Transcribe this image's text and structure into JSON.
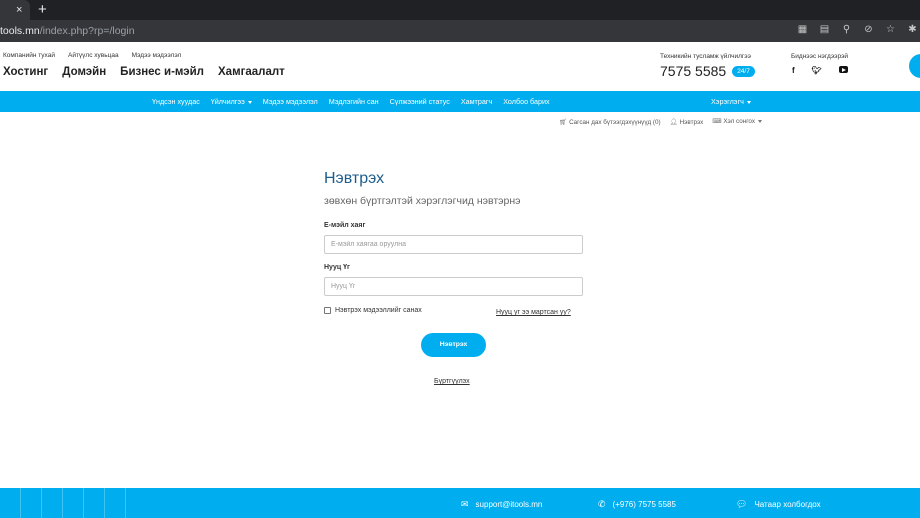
{
  "browser": {
    "tab_close": "×",
    "new_tab": "+",
    "url_host": "itools.mn",
    "url_path": "/index.php?rp=/login",
    "url_host_visible": "tools.mn"
  },
  "header": {
    "top_links": [
      "Компанийн тухай",
      "Айтүүлс хувьцаа",
      "Мэдээ мэдээлэл"
    ],
    "main_nav": [
      "Хостинг",
      "Домэйн",
      "Бизнес и-мэйл",
      "Хамгаалалт"
    ],
    "support_title": "Техникийн тусламж үйлчилгээ",
    "support_phone": "7575 5585",
    "support_badge": "24/7",
    "social_title": "Биднээс нэгдээрэй",
    "social_icons": [
      "facebook-icon",
      "twitter-icon",
      "youtube-icon"
    ]
  },
  "bluenav": {
    "items": [
      "Үндсэн хуудас",
      "Үйлчилгээ",
      "Мэдээ мэдээлэл",
      "Мэдлэгийн сан",
      "Сүлжээний статус",
      "Хамтрагч",
      "Холбоо барих"
    ],
    "user_menu": "Хэрэглэгч"
  },
  "utility": {
    "cart": "Сагсан дах бүтээгдэхүүнүүд (0)",
    "login": "Нэвтрэх",
    "language": "Хэл сонгох"
  },
  "login": {
    "title": "Нэвтрэх",
    "subtitle": "зөвхөн бүртгэлтэй хэрэглэгчид нэвтэрнэ",
    "email_label": "Е-мэйл хаяг",
    "email_placeholder": "Е-мэйл хаягаа оруулна",
    "password_label": "Нууц Үг",
    "password_placeholder": "Нууц Үг",
    "remember_label": "Нэвтрэх мэдээллийг санах",
    "forgot_link": "Нууц үг ээ мартсан уу?",
    "submit": "Нэвтрэх",
    "register_link": "Бүртгүүлэх"
  },
  "footer": {
    "email": "support@itools.mn",
    "phone": "(+976) 7575 5585",
    "chat": "Чатаар холбогдох"
  },
  "colors": {
    "accent": "#00aeef",
    "title_blue": "#1c5d8c",
    "chrome_dark": "#202124"
  }
}
